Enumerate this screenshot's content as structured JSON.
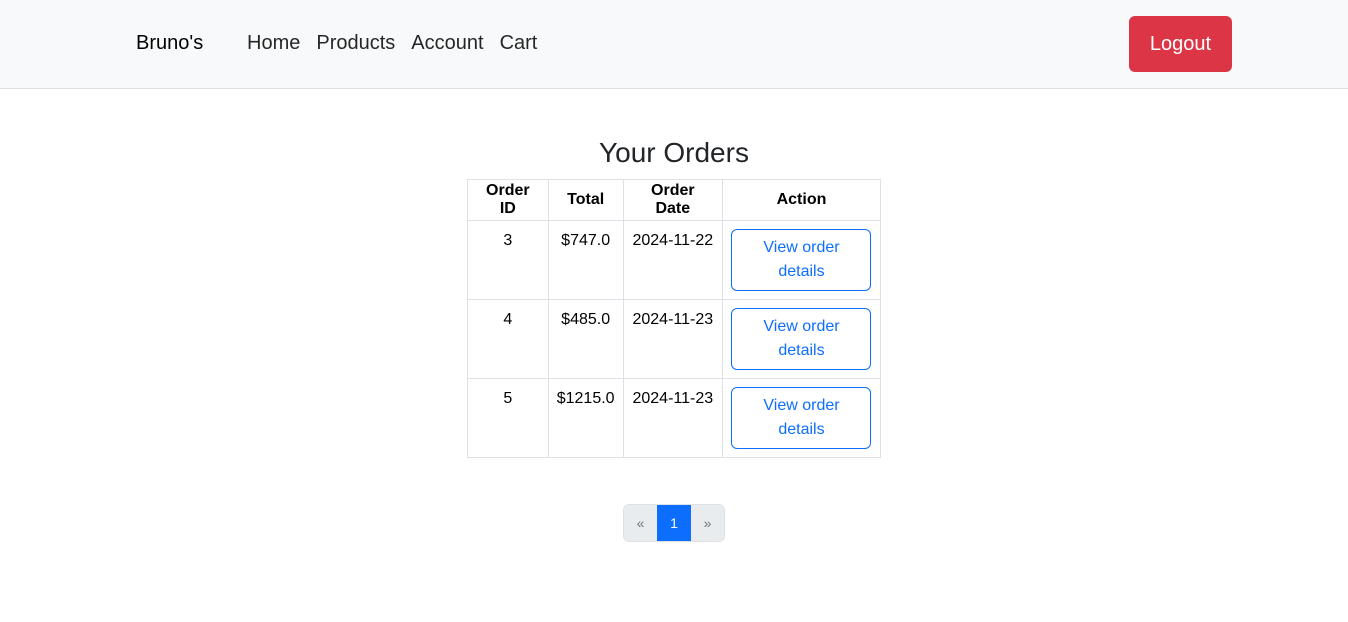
{
  "navbar": {
    "brand": "Bruno's",
    "links": [
      "Home",
      "Products",
      "Account",
      "Cart"
    ],
    "logout_label": "Logout",
    "logout_color": "#dc3545"
  },
  "main": {
    "title": "Your Orders",
    "table": {
      "headers": [
        "Order ID",
        "Total",
        "Order Date",
        "Action"
      ],
      "rows": [
        {
          "id": "3",
          "total": "$747.0",
          "date": "2024-11-22",
          "action": "View order details"
        },
        {
          "id": "4",
          "total": "$485.0",
          "date": "2024-11-23",
          "action": "View order details"
        },
        {
          "id": "5",
          "total": "$1215.0",
          "date": "2024-11-23",
          "action": "View order details"
        }
      ]
    },
    "pagination": {
      "prev": "«",
      "current": "1",
      "next": "»",
      "accent_color": "#0d6efd"
    }
  }
}
